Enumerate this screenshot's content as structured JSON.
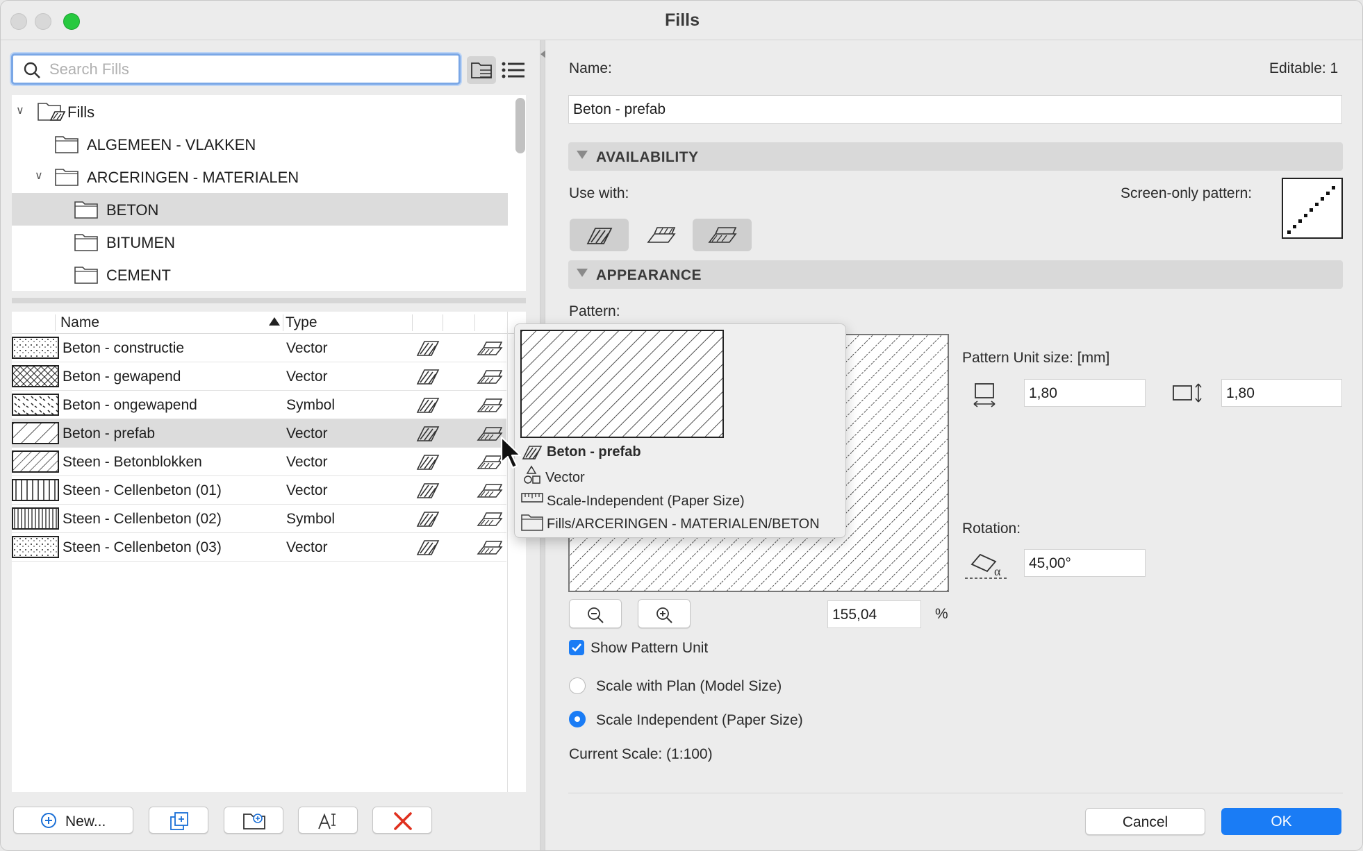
{
  "window": {
    "title": "Fills"
  },
  "search": {
    "placeholder": "Search Fills"
  },
  "tree": {
    "root": "Fills",
    "items": [
      {
        "label": "ALGEMEEN - VLAKKEN"
      },
      {
        "label": "ARCERINGEN - MATERIALEN"
      },
      {
        "label": "BETON"
      },
      {
        "label": "BITUMEN"
      },
      {
        "label": "CEMENT"
      }
    ]
  },
  "list": {
    "headers": {
      "name": "Name",
      "type": "Type"
    },
    "rows": [
      {
        "name": "Beton - constructie",
        "type": "Vector"
      },
      {
        "name": "Beton - gewapend",
        "type": "Vector"
      },
      {
        "name": "Beton - ongewapend",
        "type": "Symbol"
      },
      {
        "name": "Beton - prefab",
        "type": "Vector"
      },
      {
        "name": "Steen - Betonblokken",
        "type": "Vector"
      },
      {
        "name": "Steen - Cellenbeton (01)",
        "type": "Vector"
      },
      {
        "name": "Steen - Cellenbeton (02)",
        "type": "Symbol"
      },
      {
        "name": "Steen - Cellenbeton (03)",
        "type": "Vector"
      }
    ]
  },
  "footer_buttons": {
    "new_label": "New..."
  },
  "details": {
    "name_label": "Name:",
    "editable_label": "Editable: 1",
    "name_value": "Beton - prefab",
    "availability_title": "AVAILABILITY",
    "use_with_label": "Use with:",
    "screen_only_label": "Screen-only pattern:",
    "appearance_title": "APPEARANCE",
    "pattern_label": "Pattern:",
    "unit_size_label": "Pattern Unit size: [mm]",
    "unit_width": "1,80",
    "unit_height": "1,80",
    "rotation_label": "Rotation:",
    "rotation_value": "45,00°",
    "zoom_value": "155,04",
    "zoom_unit": "%",
    "show_unit_label": "Show Pattern Unit",
    "scale_plan_label": "Scale with Plan (Model Size)",
    "scale_indep_label": "Scale Independent (Paper Size)",
    "current_scale": "Current Scale: (1:100)",
    "cancel_label": "Cancel",
    "ok_label": "OK"
  },
  "tooltip": {
    "name": "Beton - prefab",
    "kind": "Vector",
    "scale": "Scale-Independent (Paper Size)",
    "path": "Fills/ARCERINGEN - MATERIALEN/BETON"
  },
  "colors": {
    "accent": "#1a7cf5",
    "ok_button": "#1a7cf5",
    "delete_red": "#e0301e",
    "light_red": "#d8d8d8",
    "light_green": "#27c93f",
    "selected_row": "#dcdcdc"
  }
}
